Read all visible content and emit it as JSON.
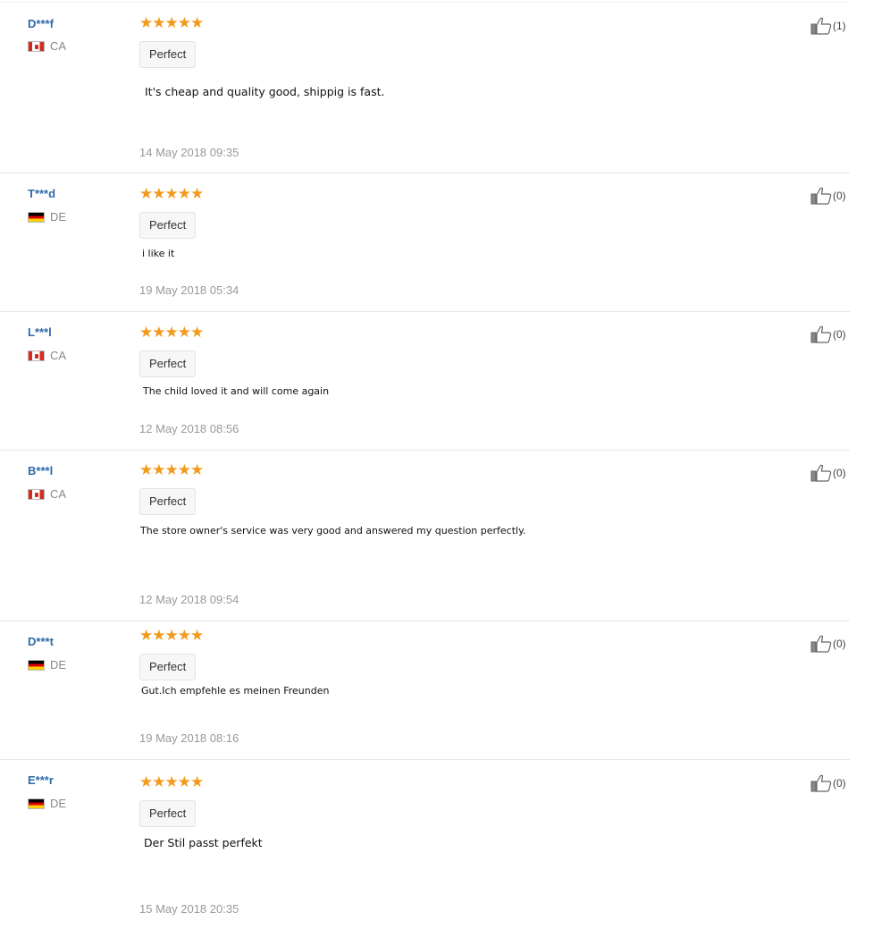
{
  "colors": {
    "username": "#2e6aa8",
    "stars": "#f29a1c",
    "date": "#999999"
  },
  "icons": {
    "like": "thumbs-up-icon",
    "star": "star-icon"
  },
  "reviews": [
    {
      "user": "D***f",
      "country": "CA",
      "flag": "canada-flag-icon",
      "rating": 5,
      "stars": "★★★★★",
      "tag": "Perfect",
      "text": "It's cheap and quality good, shippig is fast.",
      "date": "14 May 2018 09:35",
      "likes": "(1)"
    },
    {
      "user": "T***d",
      "country": "DE",
      "flag": "germany-flag-icon",
      "rating": 5,
      "stars": "★★★★★",
      "tag": "Perfect",
      "text": "i like it",
      "date": "19 May 2018 05:34",
      "likes": "(0)"
    },
    {
      "user": "L***l",
      "country": "CA",
      "flag": "canada-flag-icon",
      "rating": 5,
      "stars": "★★★★★",
      "tag": "Perfect",
      "text": "The child loved it and will come again",
      "date": "12 May 2018 08:56",
      "likes": "(0)"
    },
    {
      "user": "B***l",
      "country": "CA",
      "flag": "canada-flag-icon",
      "rating": 5,
      "stars": "★★★★★",
      "tag": "Perfect",
      "text": "The store owner's service was very good and answered my question perfectly.",
      "date": "12 May 2018 09:54",
      "likes": "(0)"
    },
    {
      "user": "D***t",
      "country": "DE",
      "flag": "germany-flag-icon",
      "rating": 5,
      "stars": "★★★★★",
      "tag": "Perfect",
      "text": "Gut.Ich empfehle es meinen Freunden",
      "date": "19 May 2018 08:16",
      "likes": "(0)"
    },
    {
      "user": "E***r",
      "country": "DE",
      "flag": "germany-flag-icon",
      "rating": 5,
      "stars": "★★★★★",
      "tag": "Perfect",
      "text": "Der Stil passt perfekt",
      "date": "15 May 2018 20:35",
      "likes": "(0)"
    }
  ]
}
